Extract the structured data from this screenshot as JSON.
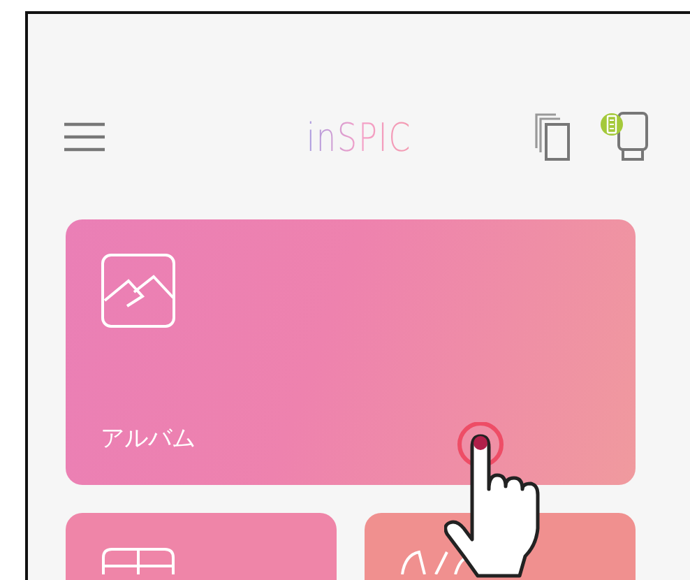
{
  "header": {
    "logo": "inSPIC"
  },
  "album_card": {
    "label": "アルバム"
  }
}
